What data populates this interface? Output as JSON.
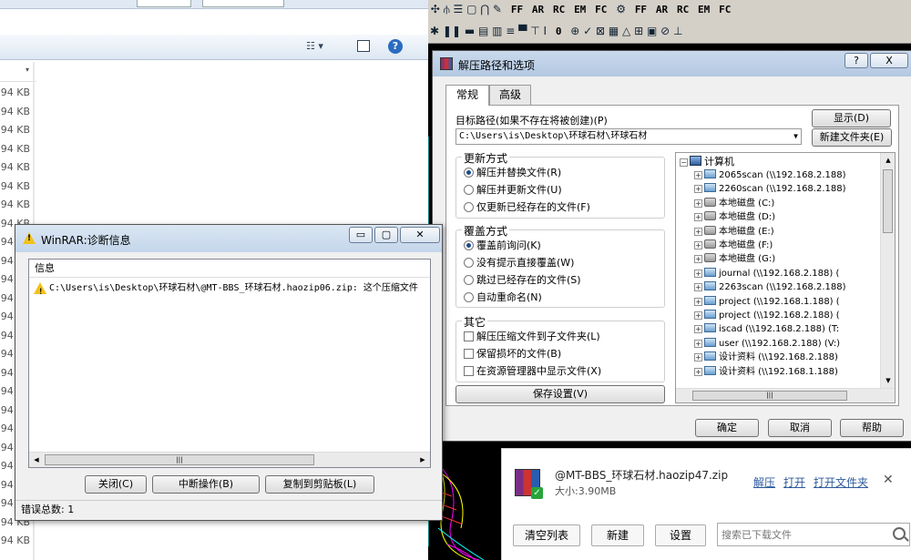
{
  "explorer": {
    "sizes": [
      "94 KB",
      "94 KB",
      "94 KB",
      "94 KB",
      "94 KB",
      "94 KB",
      "94 KB",
      "94 KB",
      "94 KB",
      "94 KB",
      "94 KB",
      "94 KB",
      "94 KB",
      "94 KB",
      "94 KB",
      "94 KB",
      "94 KB",
      "94 KB",
      "94 KB",
      "94 KB",
      "94 KB",
      "94 KB",
      "94 KB",
      "94 KB",
      "94 KB"
    ]
  },
  "cad_toolbar": {
    "labels": [
      "FF",
      "AR",
      "RC",
      "EM",
      "FC",
      "FF",
      "AR",
      "RC",
      "EM",
      "FC",
      "0"
    ]
  },
  "extract_dialog": {
    "title": "解压路径和选项",
    "help_btn": "?",
    "close_btn": "X",
    "tabs": [
      "常规",
      "高级"
    ],
    "dest_label": "目标路径(如果不存在将被创建)(P)",
    "dest_value": "C:\\Users\\is\\Desktop\\环球石材\\环球石材",
    "show_btn": "显示(D)",
    "new_folder_btn": "新建文件夹(E)",
    "update_group": {
      "legend": "更新方式",
      "options": [
        "解压并替换文件(R)",
        "解压并更新文件(U)",
        "仅更新已经存在的文件(F)"
      ],
      "selected": 0
    },
    "overwrite_group": {
      "legend": "覆盖方式",
      "options": [
        "覆盖前询问(K)",
        "没有提示直接覆盖(W)",
        "跳过已经存在的文件(S)",
        "自动重命名(N)"
      ],
      "selected": 0
    },
    "misc_group": {
      "legend": "其它",
      "options": [
        "解压压缩文件到子文件夹(L)",
        "保留损坏的文件(B)",
        "在资源管理器中显示文件(X)"
      ]
    },
    "save_btn": "保存设置(V)",
    "tree": {
      "root": "计算机",
      "items": [
        {
          "label": "2065scan (\\\\192.168.2.188)",
          "icon": "network-drive-icon"
        },
        {
          "label": "2260scan (\\\\192.168.2.188)",
          "icon": "network-drive-icon"
        },
        {
          "label": "本地磁盘 (C:)",
          "icon": "local-disk-icon"
        },
        {
          "label": "本地磁盘 (D:)",
          "icon": "local-disk-icon"
        },
        {
          "label": "本地磁盘 (E:)",
          "icon": "local-disk-icon"
        },
        {
          "label": "本地磁盘 (F:)",
          "icon": "local-disk-icon"
        },
        {
          "label": "本地磁盘 (G:)",
          "icon": "local-disk-icon"
        },
        {
          "label": "journal (\\\\192.168.2.188) (",
          "icon": "network-drive-icon"
        },
        {
          "label": "2263scan (\\\\192.168.2.188)",
          "icon": "network-drive-icon"
        },
        {
          "label": "project (\\\\192.168.1.188) (",
          "icon": "network-drive-icon"
        },
        {
          "label": "project (\\\\192.168.2.188) (",
          "icon": "network-drive-icon"
        },
        {
          "label": "iscad (\\\\192.168.2.188) (T:",
          "icon": "network-drive-icon"
        },
        {
          "label": "user (\\\\192.168.2.188) (V:)",
          "icon": "network-drive-icon"
        },
        {
          "label": "设计资料 (\\\\192.168.2.188)",
          "icon": "network-drive-icon"
        },
        {
          "label": "设计资料 (\\\\192.168.1.188)",
          "icon": "network-drive-icon"
        }
      ]
    },
    "ok_btn": "确定",
    "cancel_btn": "取消",
    "help_btn2": "帮助"
  },
  "diag_dialog": {
    "title": "WinRAR:诊断信息",
    "list_header": "信息",
    "message": "C:\\Users\\is\\Desktop\\环球石材\\@MT-BBS_环球石材.haozip06.zip: 这个压缩文件",
    "close_btn": "关闭(C)",
    "abort_btn": "中断操作(B)",
    "copy_btn": "复制到剪贴板(L)",
    "status": "错误总数: 1"
  },
  "download": {
    "filename": "@MT-BBS_环球石材.haozip47.zip",
    "size": "大小:3.90MB",
    "extract_link": "解压",
    "open_link": "打开",
    "open_folder_link": "打开文件夹",
    "clear_btn": "清空列表",
    "new_btn": "新建",
    "settings_btn": "设置",
    "search_placeholder": "搜索已下载文件"
  }
}
